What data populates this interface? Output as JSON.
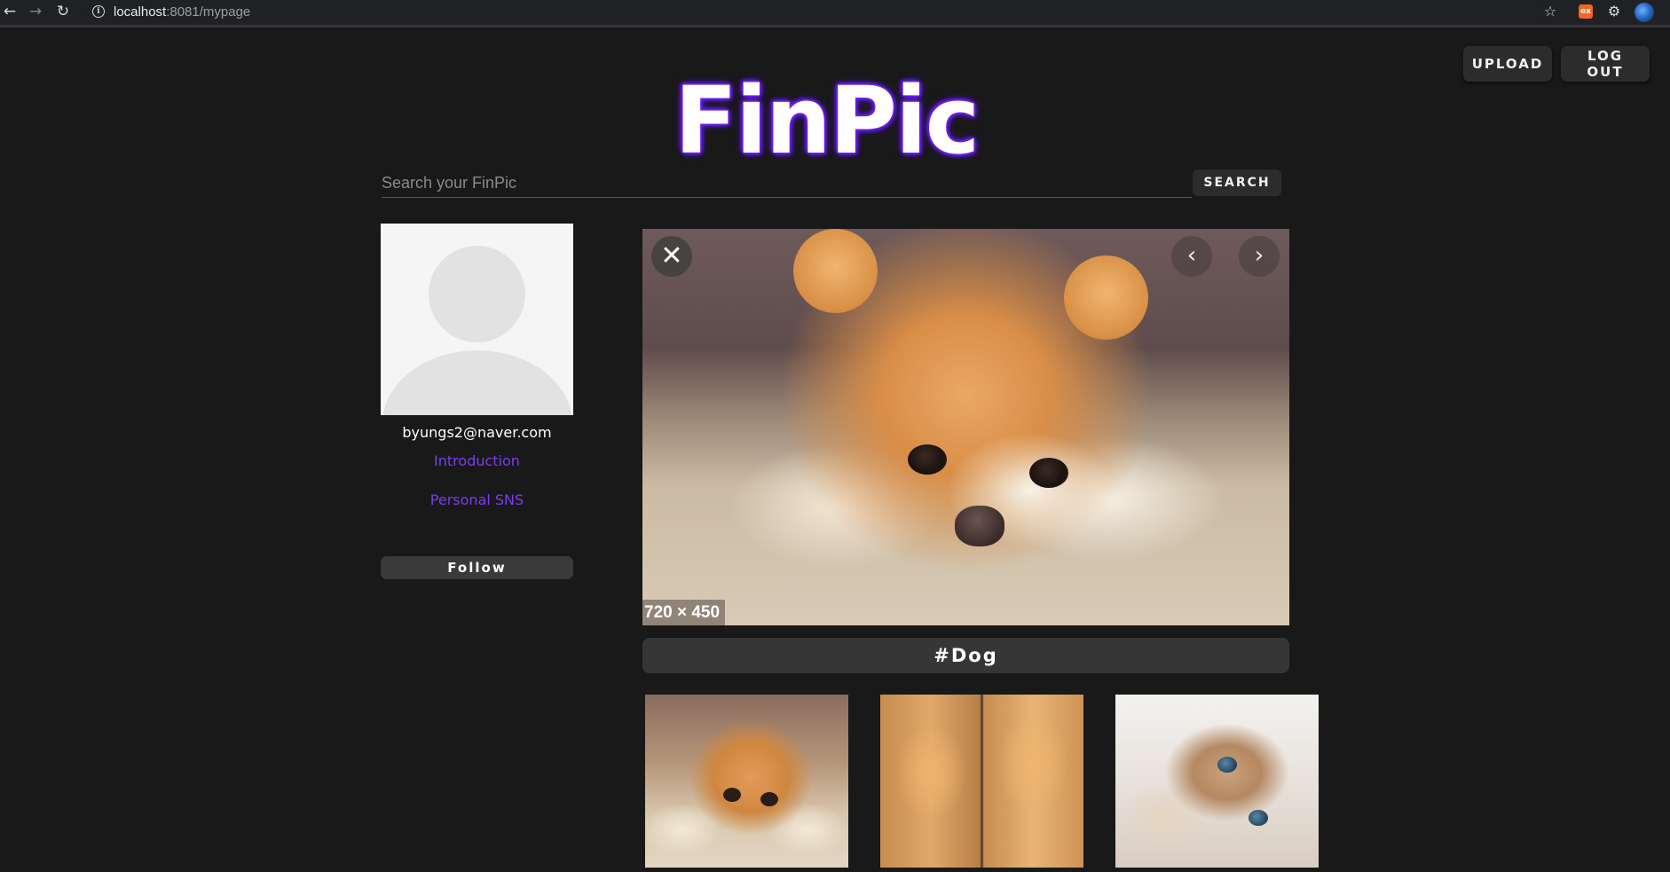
{
  "browser": {
    "url_host": "localhost",
    "url_rest": ":8081/mypage"
  },
  "header": {
    "upload_label": "UPLOAD",
    "logout_label": "LOG OUT",
    "logo": "FinPic"
  },
  "search": {
    "placeholder": "Search your FinPic",
    "button_label": "SEARCH"
  },
  "profile": {
    "email": "byungs2@naver.com",
    "introduction_label": "Introduction",
    "sns_label": "Personal SNS",
    "follow_label": "Follow"
  },
  "viewer": {
    "dimensions_badge": "720 × 450",
    "tag": "#Dog"
  },
  "colors": {
    "background": "#191919",
    "accent": "#7d3cf0",
    "button_bg": "#2c2c2c"
  }
}
